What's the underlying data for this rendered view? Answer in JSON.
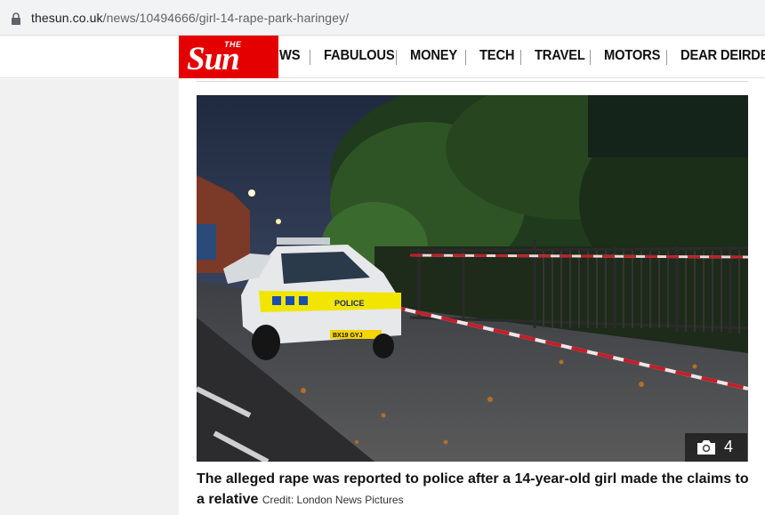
{
  "browser": {
    "url_host": "thesun.co.uk",
    "url_path": "/news/10494666/girl-14-rape-park-haringey/"
  },
  "site": {
    "logo_the": "THE",
    "logo_name": "Sun",
    "brand_color": "#e50000",
    "nav": [
      {
        "label": "WS"
      },
      {
        "label": "FABULOUS"
      },
      {
        "label": "MONEY"
      },
      {
        "label": "TECH"
      },
      {
        "label": "TRAVEL"
      },
      {
        "label": "MOTORS"
      },
      {
        "label": "DEAR DEIRDE"
      }
    ]
  },
  "article": {
    "gallery_count": "4",
    "caption": "The alleged rape was reported to police after a 14-year-old girl made the claims to a relative",
    "credit": "Credit: London News Pictures",
    "police_car_text": "POLICE",
    "number_plate": "BX19 GYJ"
  },
  "icons": {
    "lock": "lock-icon",
    "camera": "camera-icon"
  }
}
